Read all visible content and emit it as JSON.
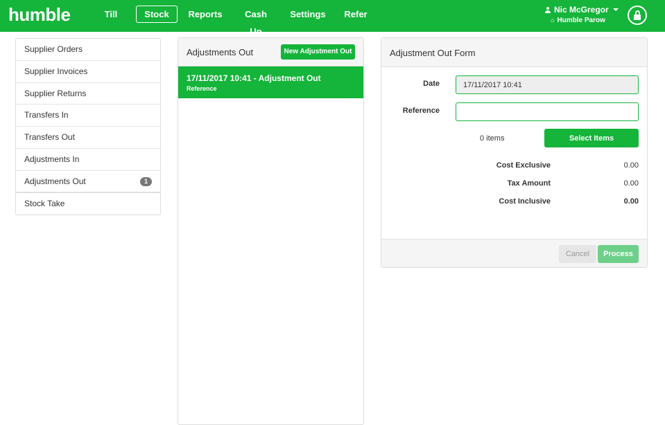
{
  "brand": {
    "logo_text": "humble",
    "accent": "#15b43a"
  },
  "nav": {
    "items": [
      {
        "label": "Till",
        "active": false
      },
      {
        "label": "Stock",
        "active": true
      },
      {
        "label": "Reports",
        "active": false
      },
      {
        "label": "Cash Up",
        "active": false
      },
      {
        "label": "Settings",
        "active": false
      },
      {
        "label": "Refer",
        "active": false
      }
    ]
  },
  "user": {
    "name": "Nic McGregor",
    "store": "Humble Parow",
    "icons": {
      "user": "user-icon",
      "store": "home-icon",
      "dropdown": "caret-down-icon",
      "lock": "lock-icon"
    }
  },
  "sidebar": {
    "items": [
      {
        "label": "Supplier Orders"
      },
      {
        "label": "Supplier Invoices"
      },
      {
        "label": "Supplier Returns"
      },
      {
        "label": "Transfers In"
      },
      {
        "label": "Transfers Out"
      },
      {
        "label": "Adjustments In"
      },
      {
        "label": "Adjustments Out",
        "badge": "1"
      },
      {
        "label": "Stock Take"
      }
    ]
  },
  "list_panel": {
    "title": "Adjustments Out",
    "new_button": "New Adjustment Out",
    "rows": [
      {
        "title": "17/11/2017 10:41 - Adjustment Out",
        "subtitle": "Reference"
      }
    ]
  },
  "form": {
    "title": "Adjustment Out Form",
    "date_label": "Date",
    "date_value": "17/11/2017 10:41",
    "reference_label": "Reference",
    "reference_value": "",
    "items_count": "0 items",
    "select_items_button": "Select Items",
    "cost_exclusive_label": "Cost Exclusive",
    "cost_exclusive_value": "0.00",
    "tax_amount_label": "Tax Amount",
    "tax_amount_value": "0.00",
    "cost_inclusive_label": "Cost Inclusive",
    "cost_inclusive_value": "0.00",
    "cancel_button": "Cancel",
    "process_button": "Process"
  }
}
